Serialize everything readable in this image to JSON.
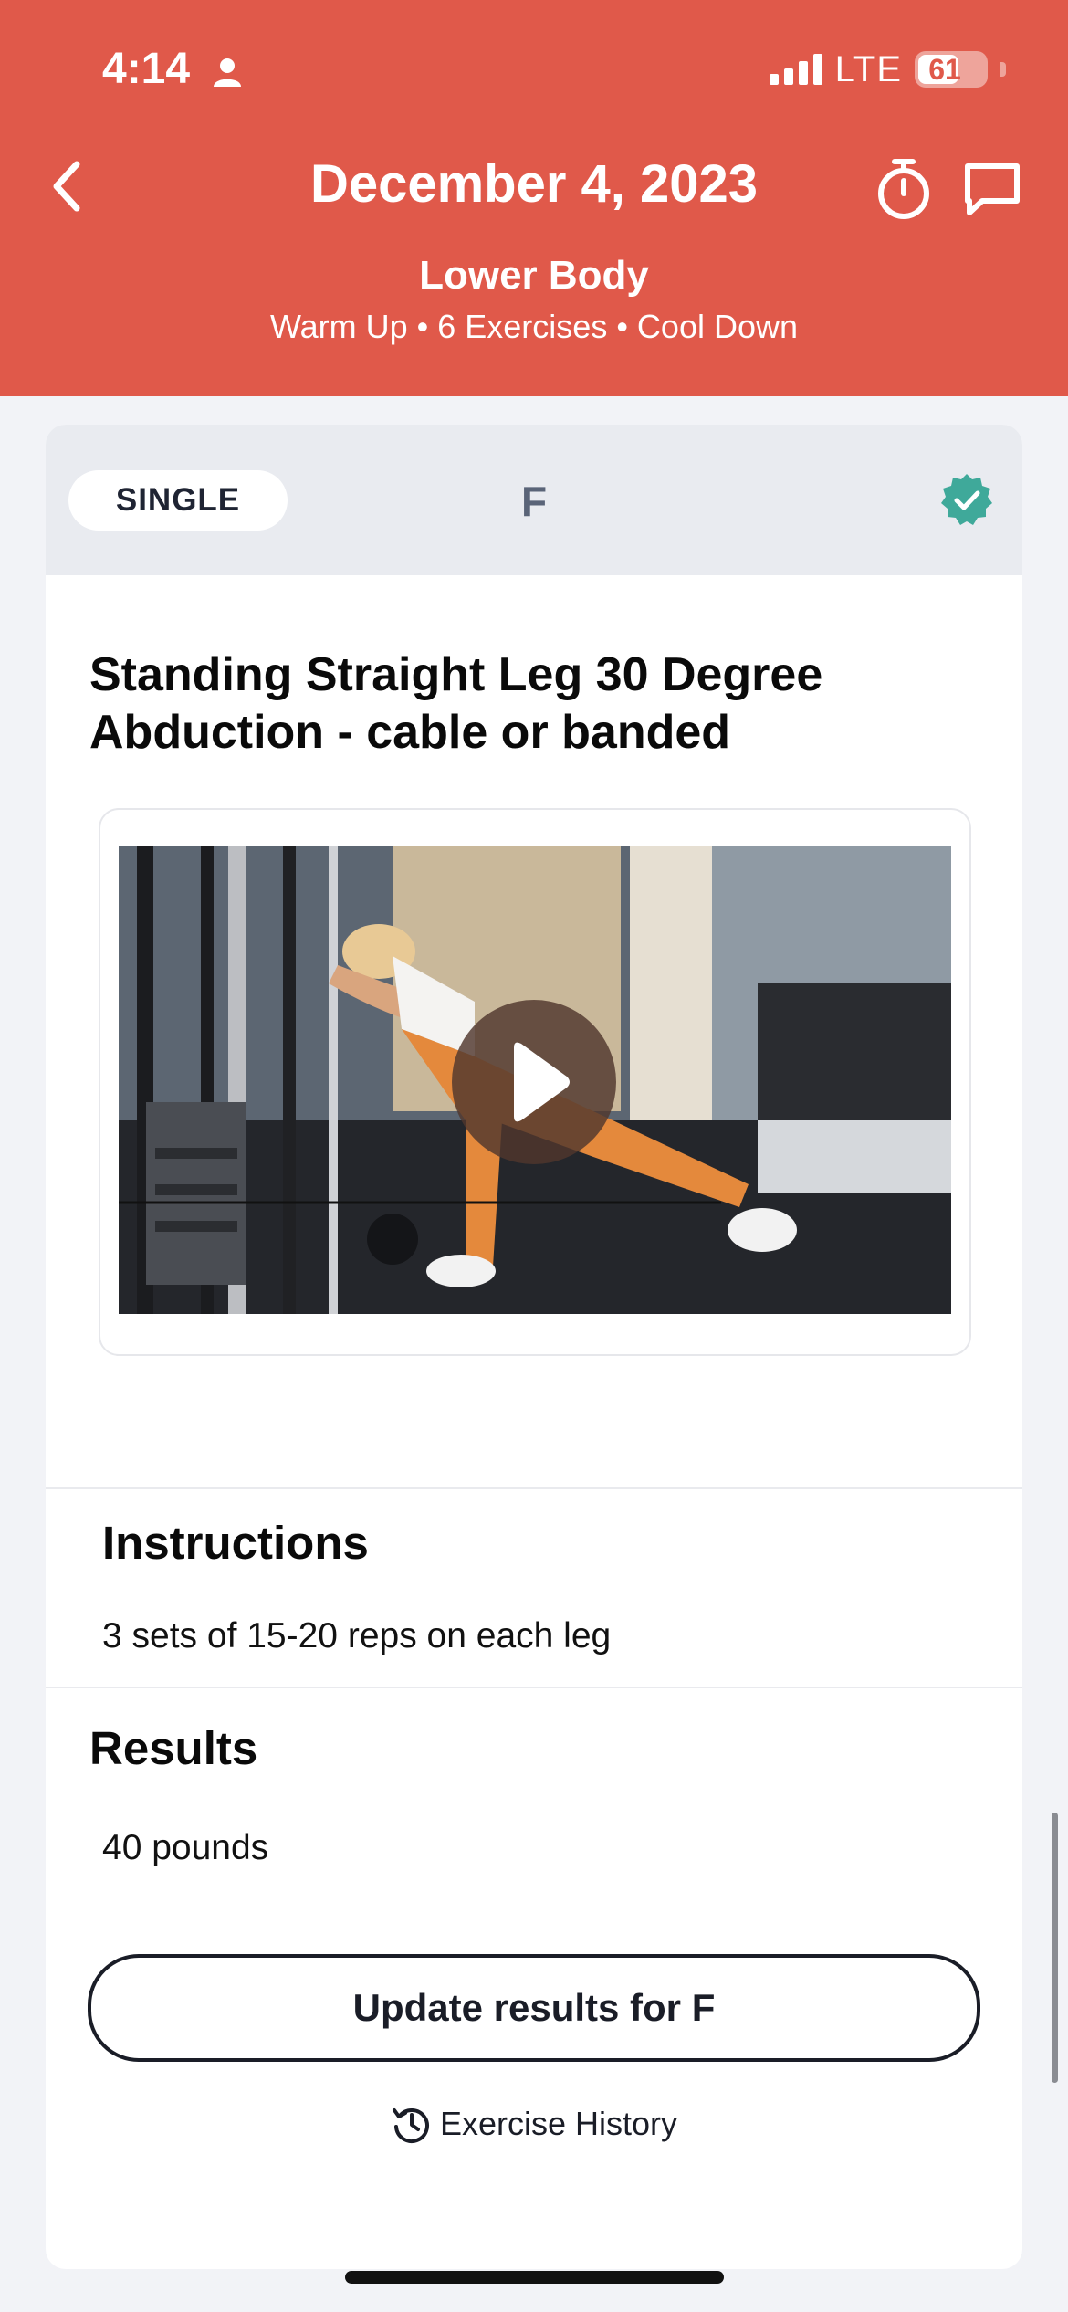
{
  "status_bar": {
    "time": "4:14",
    "network": "LTE",
    "battery": "61"
  },
  "header": {
    "title": "December 4, 2023",
    "subtitle": "Lower Body",
    "meta": "Warm Up • 6 Exercises • Cool Down",
    "icons": [
      "chevron-left-icon",
      "stopwatch-icon",
      "chat-bubble-icon"
    ]
  },
  "exercise_card": {
    "type_label": "SINGLE",
    "letter": "F",
    "completed": true,
    "title": "Standing Straight Leg 30 Degree Abduction - cable or banded",
    "video": {
      "icon": "play-icon"
    },
    "instructions_heading": "Instructions",
    "instructions_text": "3 sets of 15-20 reps on each leg",
    "results_heading": "Results",
    "results_text": "40 pounds",
    "update_button": "Update results for F",
    "history_link": "Exercise History"
  },
  "colors": {
    "header_bg": "#e0594a",
    "check_badge": "#3fa99a",
    "page_bg": "#f2f3f7"
  }
}
